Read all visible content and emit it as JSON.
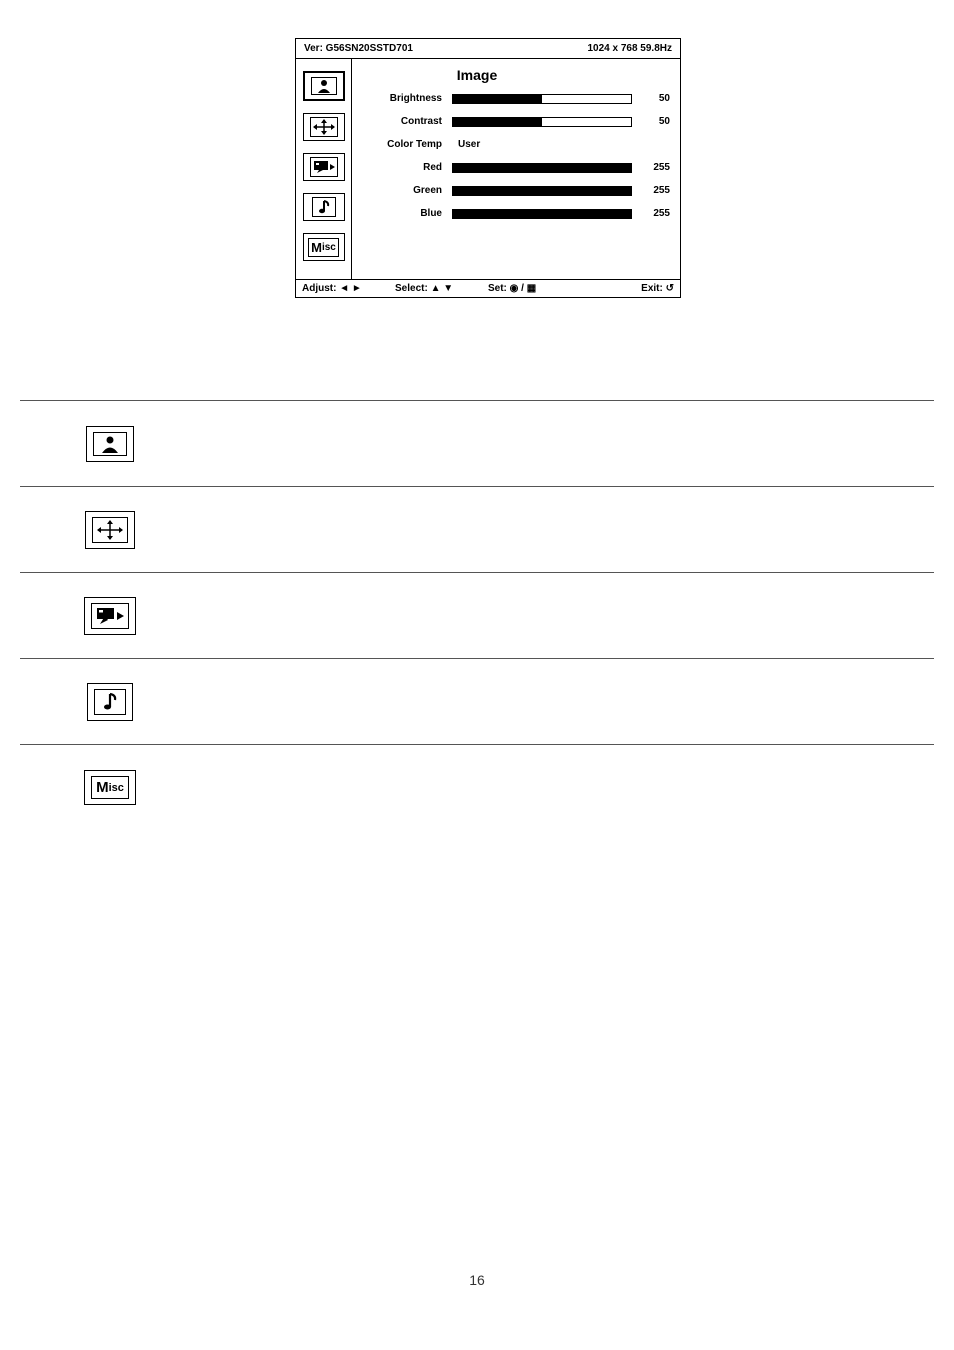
{
  "osd": {
    "header": {
      "version": "Ver: G56SN20SSTD701",
      "resolution": "1024 x 768  59.8Hz"
    },
    "title": "Image",
    "rows": {
      "brightness": {
        "label": "Brightness",
        "value": "50",
        "fill_pct": 50
      },
      "contrast": {
        "label": "Contrast",
        "value": "50",
        "fill_pct": 50
      },
      "colortemp": {
        "label": "Color Temp",
        "text": "User"
      },
      "red": {
        "label": "Red",
        "value": "255",
        "fill_pct": 100
      },
      "green": {
        "label": "Green",
        "value": "255",
        "fill_pct": 100
      },
      "blue": {
        "label": "Blue",
        "value": "255",
        "fill_pct": 100
      }
    },
    "footer": {
      "adjust": "Adjust: ◄ ►",
      "select": "Select: ▲ ▼",
      "set": "Set: ◉ / ▦",
      "exit": "Exit: ↺"
    },
    "sidebar": {
      "image_icon": "image-icon",
      "position_icon": "position-icon",
      "language_icon": "language-icon",
      "audio_icon": "audio-icon",
      "misc_label_big": "M",
      "misc_label_small": "isc"
    }
  },
  "page_number": "16"
}
